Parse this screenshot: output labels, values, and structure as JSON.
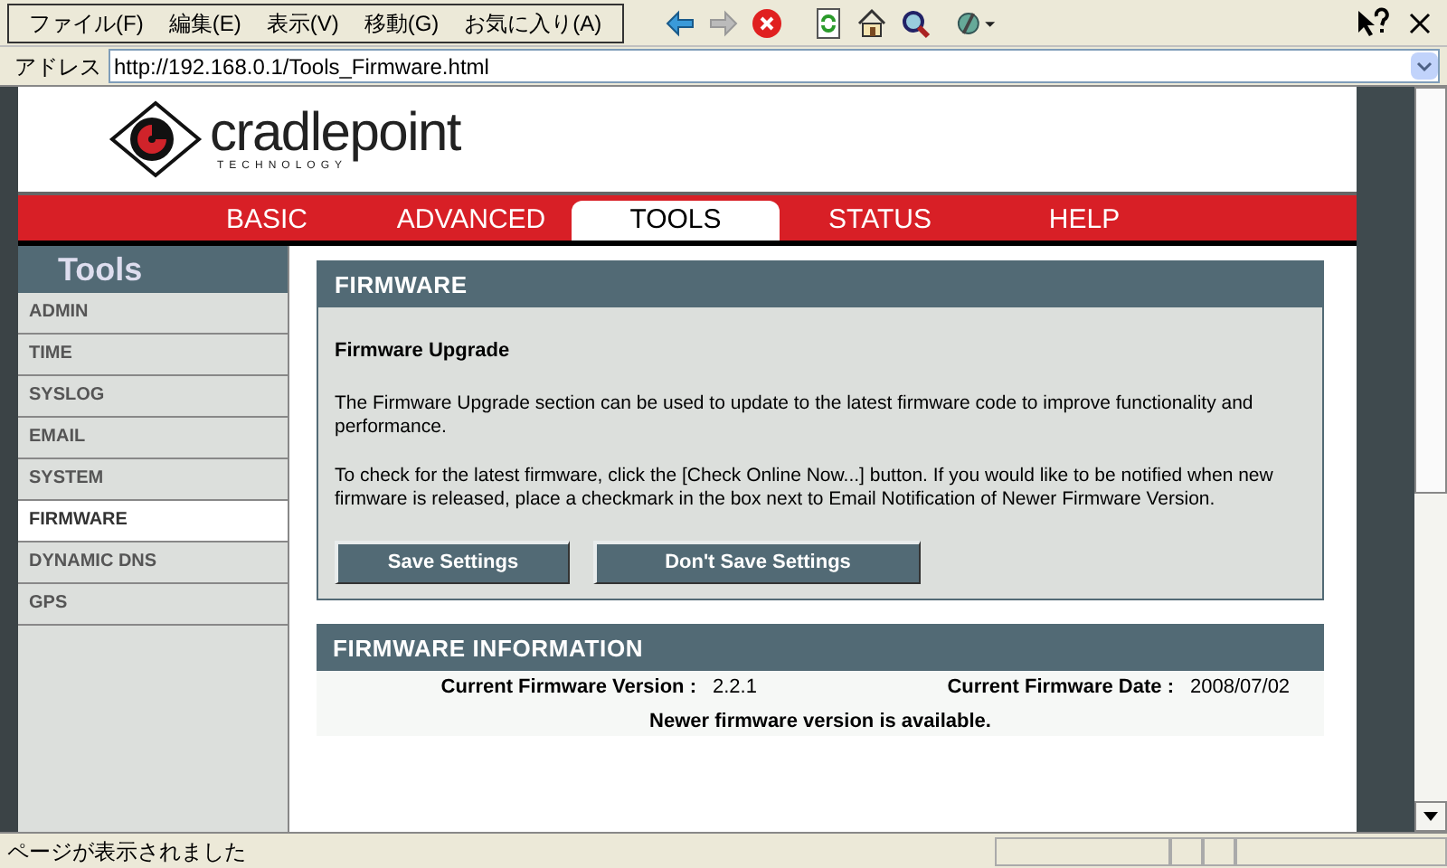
{
  "menu_bar": [
    "ファイル(F)",
    "編集(E)",
    "表示(V)",
    "移動(G)",
    "お気に入り(A)"
  ],
  "address_bar": {
    "label": "アドレス",
    "value": "http://192.168.0.1/Tools_Firmware.html"
  },
  "logo": {
    "name": "cradlepoint",
    "tagline": "TECHNOLOGY"
  },
  "nav_tabs": [
    {
      "label": "BASIC",
      "selected": false
    },
    {
      "label": "ADVANCED",
      "selected": false
    },
    {
      "label": "TOOLS",
      "selected": true
    },
    {
      "label": "STATUS",
      "selected": false
    },
    {
      "label": "HELP",
      "selected": false
    }
  ],
  "sidebar": {
    "title": "Tools",
    "items": [
      {
        "label": "ADMIN",
        "selected": false
      },
      {
        "label": "TIME",
        "selected": false
      },
      {
        "label": "SYSLOG",
        "selected": false
      },
      {
        "label": "EMAIL",
        "selected": false
      },
      {
        "label": "SYSTEM",
        "selected": false
      },
      {
        "label": "FIRMWARE",
        "selected": true
      },
      {
        "label": "DYNAMIC DNS",
        "selected": false
      },
      {
        "label": "GPS",
        "selected": false
      }
    ]
  },
  "firmware_panel": {
    "title": "FIRMWARE",
    "subtitle": "Firmware Upgrade",
    "paragraphs": [
      "The Firmware Upgrade section can be used to update to the latest firmware code to improve functionality and performance.",
      "To check for the latest firmware, click the [Check Online Now...] button. If you would like to be notified when new firmware is released, place a checkmark in the box next to Email Notification of Newer Firmware Version."
    ],
    "buttons": [
      "Save Settings",
      "Don't Save Settings"
    ]
  },
  "info_panel": {
    "title": "FIRMWARE INFORMATION",
    "version_label": "Current Firmware Version :",
    "version": "2.2.1",
    "date_label": "Current Firmware Date :",
    "date": "2008/07/02",
    "notice": "Newer firmware version is available."
  },
  "status_bar": {
    "text": "ページが表示されました"
  }
}
